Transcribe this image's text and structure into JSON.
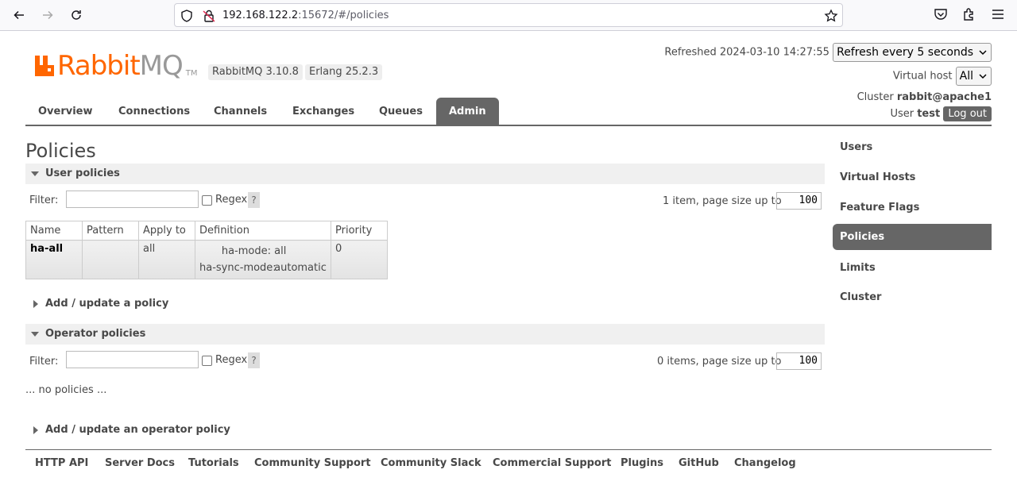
{
  "browser": {
    "url_host": "192.168.122.2",
    "url_rest": ":15672/#/policies"
  },
  "header": {
    "logo_rabbit": "Rabbit",
    "logo_mq": "MQ",
    "logo_tm": "TM",
    "version_badge": "RabbitMQ 3.10.8",
    "erlang_badge": "Erlang 25.2.3",
    "refreshed_text": "Refreshed 2024-03-10 14:27:55",
    "refresh_select": "Refresh every 5 seconds",
    "vhost_label": "Virtual host",
    "vhost_select": "All",
    "cluster_label": "Cluster",
    "cluster_name": "rabbit@apache1",
    "user_label": "User",
    "user_name": "test",
    "logout_label": "Log out"
  },
  "tabs": [
    {
      "label": "Overview"
    },
    {
      "label": "Connections"
    },
    {
      "label": "Channels"
    },
    {
      "label": "Exchanges"
    },
    {
      "label": "Queues"
    },
    {
      "label": "Admin"
    }
  ],
  "page_title": "Policies",
  "user_policies": {
    "title": "User policies",
    "filter_label": "Filter:",
    "filter_value": "",
    "regex_label": "Regex",
    "help": "?",
    "page_info": "1 item, page size up to",
    "page_size": "100",
    "columns": [
      "Name",
      "Pattern",
      "Apply to",
      "Definition",
      "Priority"
    ],
    "rows": [
      {
        "name": "ha-all",
        "pattern": "",
        "apply_to": "all",
        "definition": [
          {
            "key": "ha-mode:",
            "value": "all"
          },
          {
            "key": "ha-sync-mode:",
            "value": "automatic"
          }
        ],
        "priority": "0"
      }
    ],
    "add_update": "Add / update a policy"
  },
  "operator_policies": {
    "title": "Operator policies",
    "filter_label": "Filter:",
    "filter_value": "",
    "regex_label": "Regex",
    "help": "?",
    "page_info": "0 items, page size up to",
    "page_size": "100",
    "empty_text": "... no policies ...",
    "add_update": "Add / update an operator policy"
  },
  "side_menu": [
    {
      "label": "Users"
    },
    {
      "label": "Virtual Hosts"
    },
    {
      "label": "Feature Flags"
    },
    {
      "label": "Policies"
    },
    {
      "label": "Limits"
    },
    {
      "label": "Cluster"
    }
  ],
  "footer": [
    {
      "label": "HTTP API"
    },
    {
      "label": "Server Docs"
    },
    {
      "label": "Tutorials"
    },
    {
      "label": "Community Support"
    },
    {
      "label": "Community Slack"
    },
    {
      "label": "Commercial Support"
    },
    {
      "label": "Plugins"
    },
    {
      "label": "GitHub"
    },
    {
      "label": "Changelog"
    }
  ],
  "colors": {
    "brand_orange": "#ff6600",
    "tab_active": "#666666"
  }
}
